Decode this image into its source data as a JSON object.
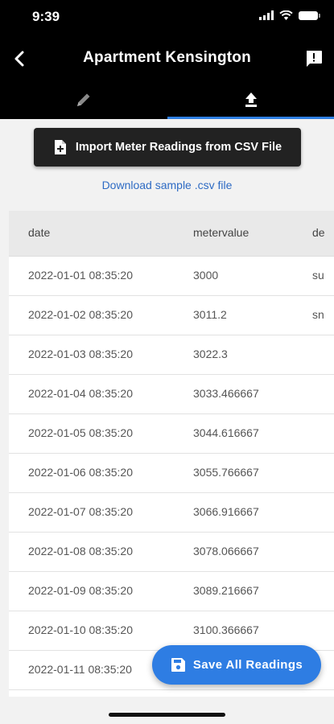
{
  "status_bar": {
    "time": "9:39"
  },
  "nav": {
    "title": "Apartment Kensington"
  },
  "tabs": [
    {
      "icon": "pencil-icon",
      "selected": false
    },
    {
      "icon": "upload-icon",
      "selected": true
    }
  ],
  "import_button": {
    "label": "Import Meter Readings from CSV File"
  },
  "download_link": {
    "label": "Download sample .csv file"
  },
  "table": {
    "columns": [
      "date",
      "metervalue",
      "de"
    ],
    "rows": [
      [
        "2022-01-01 08:35:20",
        "3000",
        "su"
      ],
      [
        "2022-01-02 08:35:20",
        "3011.2",
        "sn"
      ],
      [
        "2022-01-03 08:35:20",
        "3022.3",
        ""
      ],
      [
        "2022-01-04 08:35:20",
        "3033.466667",
        ""
      ],
      [
        "2022-01-05 08:35:20",
        "3044.616667",
        ""
      ],
      [
        "2022-01-06 08:35:20",
        "3055.766667",
        ""
      ],
      [
        "2022-01-07 08:35:20",
        "3066.916667",
        ""
      ],
      [
        "2022-01-08 08:35:20",
        "3078.066667",
        ""
      ],
      [
        "2022-01-09 08:35:20",
        "3089.216667",
        ""
      ],
      [
        "2022-01-10 08:35:20",
        "3100.366667",
        ""
      ],
      [
        "2022-01-11 08:35:20",
        "",
        ""
      ]
    ]
  },
  "fab": {
    "label": "Save All Readings"
  },
  "colors": {
    "accent": "#2e7de3",
    "header_bg": "#000000",
    "link": "#2e6bc4"
  }
}
